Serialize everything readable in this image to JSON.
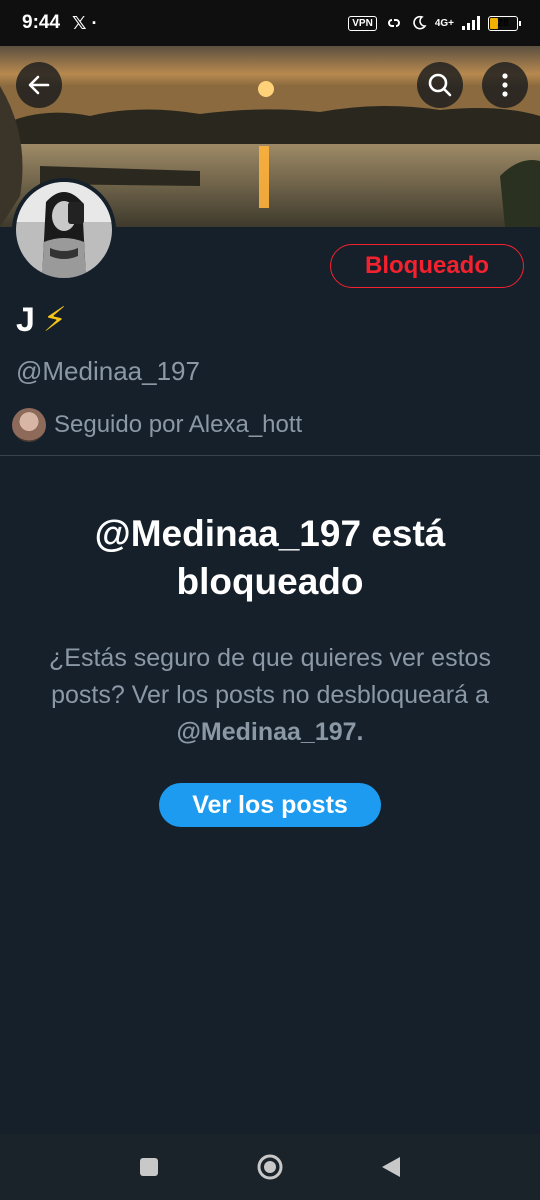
{
  "status_bar": {
    "time": "9:44",
    "app_icons": "𝕏 ·",
    "vpn": "VPN",
    "network": "4G+",
    "battery": "28",
    "battery_level": 0.28,
    "battery_color": "#f2b100"
  },
  "header": {
    "back_icon": "arrow-left-icon",
    "search_icon": "search-icon",
    "more_icon": "more-vertical-icon"
  },
  "profile": {
    "display_name": "J",
    "name_emoji": "⚡",
    "handle": "@Medinaa_197",
    "followed_by": "Seguido por Alexa_hott",
    "blocked_label": "Bloqueado"
  },
  "blocked_notice": {
    "title": "@Medinaa_197 está bloqueado",
    "description": "¿Estás seguro de que quieres ver estos posts? Ver los posts no desbloqueará a",
    "description_handle": "@Medinaa_197.",
    "button_label": "Ver los posts"
  },
  "colors": {
    "background": "#15202b",
    "accent": "#1d9bf0",
    "danger": "#f4212e",
    "secondary_text": "#8b98a5"
  }
}
